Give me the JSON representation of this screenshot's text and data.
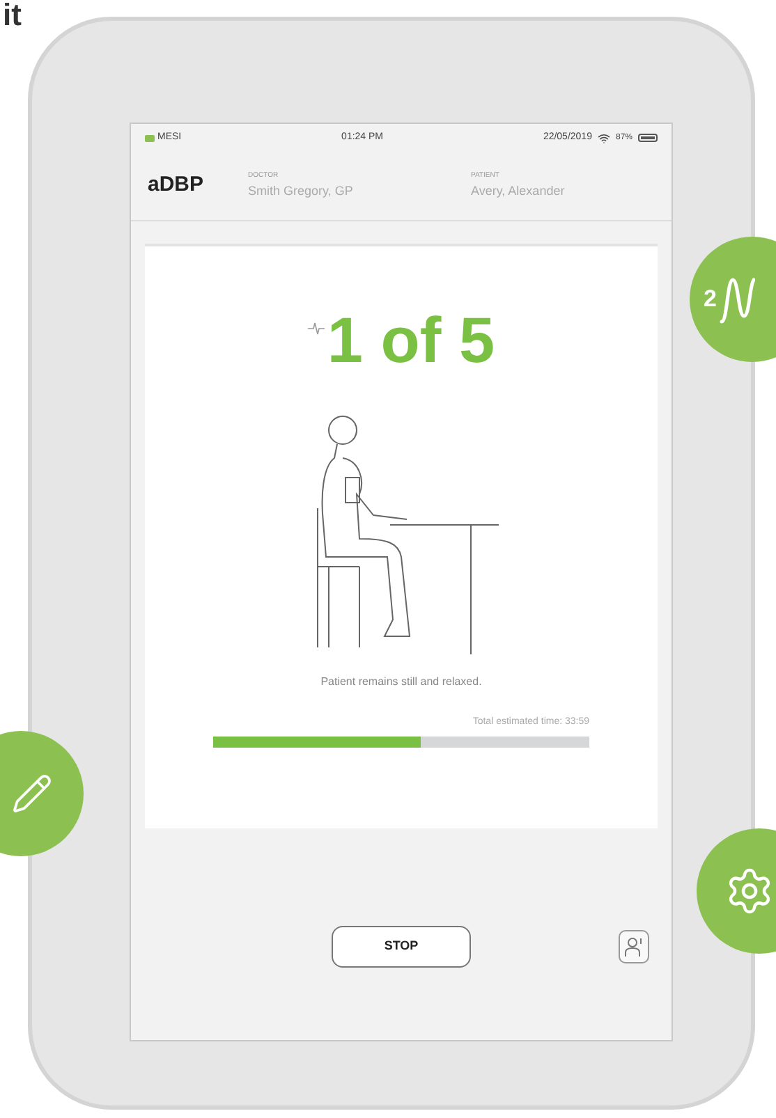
{
  "heading": "it",
  "status_bar": {
    "carrier": "MESI",
    "time": "01:24 PM",
    "date": "22/05/2019",
    "battery": "87%"
  },
  "header": {
    "title": "aDBP",
    "doctor_label": "DOCTOR",
    "doctor": "Smith Gregory, GP",
    "patient_label": "PATIENT",
    "patient": "Avery, Alexander"
  },
  "measurement": {
    "counter": "1 of 5",
    "instruction": "Patient remains still and relaxed.",
    "time_label": "Total estimated time: 33:59",
    "level": 0.55
  },
  "buttons": [
    {
      "label": "STOP"
    }
  ],
  "badges": [
    {
      "kind": "wave",
      "label": "2"
    },
    {
      "kind": "pencil"
    },
    {
      "kind": "gear"
    }
  ]
}
